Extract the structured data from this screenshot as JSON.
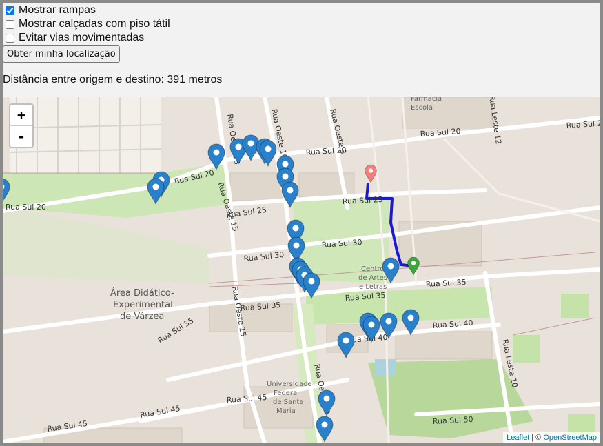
{
  "controls": {
    "ramps_label": "Mostrar rampas",
    "ramps_checked": true,
    "tactile_label": "Mostrar calçadas com piso tátil",
    "tactile_checked": false,
    "avoid_label": "Evitar vias movimentadas",
    "avoid_checked": false,
    "location_button": "Obter minha localização"
  },
  "distance_text": "Distância entre origem e destino: 391 metros",
  "map": {
    "zoom_in": "+",
    "zoom_out": "-",
    "attribution_leaflet": "Leaflet",
    "attribution_sep": " | © ",
    "attribution_osm": "OpenStreetMap",
    "colors": {
      "route": "#1a1ad4",
      "ramp_marker": "#2a81cb",
      "origin_marker": "#f47e7e",
      "destination_marker": "#3aa73a"
    },
    "streets": {
      "sul20_a": "Rua Sul 20",
      "sul20_b": "Rua Sul 20",
      "sul20_c": "Rua Sul 20",
      "sul20_d": "Rua Sul 20",
      "sul20_e": "Rua Sul 20",
      "sul25_a": "Rua Sul 25",
      "sul25_b": "Rua Sul 25",
      "sul30_a": "Rua Sul 30",
      "sul30_b": "Rua Sul 30",
      "sul35_a": "Rua Sul 35",
      "sul35_b": "Rua Sul 35",
      "sul35_c": "Rua Sul 35",
      "sul35_d": "Rua Sul 35",
      "sul40_a": "Rua Sul 40",
      "sul40_b": "Rua Sul 40",
      "sul45_a": "Rua Sul 45",
      "sul45_b": "Rua Sul 45",
      "sul45_c": "Rua Sul 45",
      "sul50": "Rua Sul 50",
      "oeste15_a": "Rua Oeste 15",
      "oeste15_b": "Rua Oeste 15",
      "oeste10_a": "Rua Oeste 10",
      "oeste10_b": "Rua Oeste 10",
      "oeste3": "Rua Oeste 3",
      "leste10": "Rua Leste 10",
      "leste12": "Rua Leste 12"
    },
    "places": {
      "farmacia_1": "Farmácia",
      "farmacia_2": "Escola",
      "centro_1": "Centro",
      "centro_2": "de Artes",
      "centro_3": "e Letras",
      "area_1": "Área Didático-",
      "area_2": "Experimental",
      "area_3": "de Várzea",
      "univ_1": "Universidade",
      "univ_2": "Federal",
      "univ_3": "de Santa",
      "univ_4": "Maria"
    }
  }
}
